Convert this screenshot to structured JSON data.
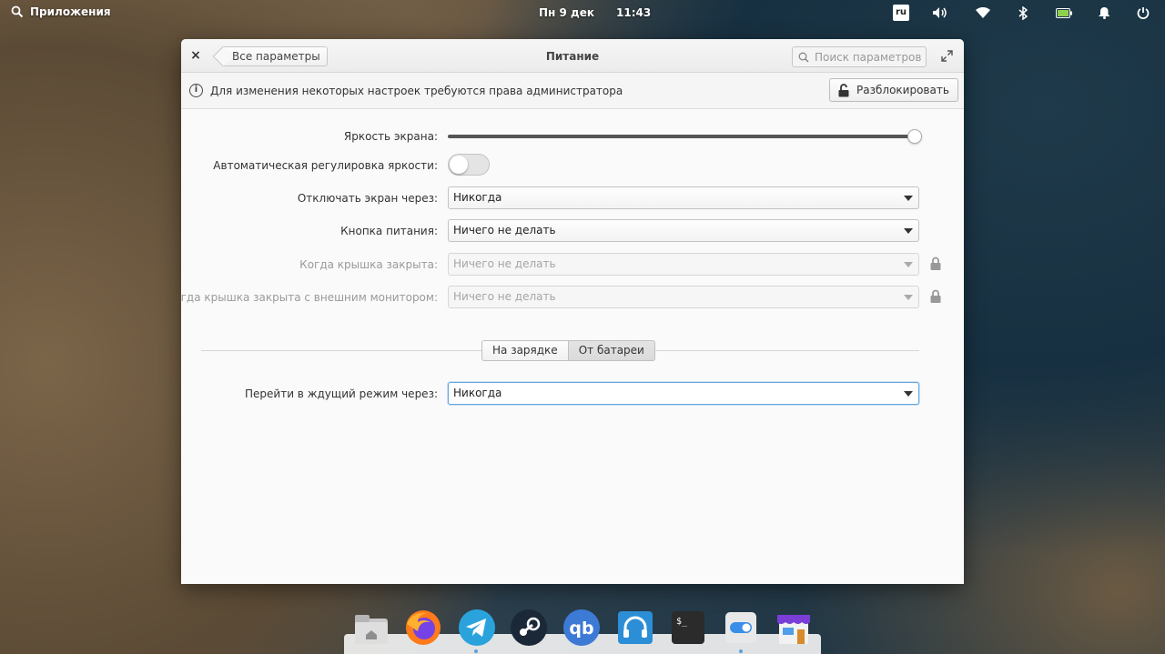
{
  "panel": {
    "applications_label": "Приложения",
    "date": "Пн  9 дек",
    "time": "11:43",
    "keyboard_layout": "ru"
  },
  "window": {
    "title": "Питание",
    "back_label": "Все параметры",
    "search_placeholder": "Поиск параметров"
  },
  "infobar": {
    "message": "Для изменения некоторых настроек требуются права администратора",
    "unlock_label": "Разблокировать"
  },
  "settings": {
    "brightness_label": "Яркость экрана:",
    "brightness_value": 1.0,
    "auto_brightness_label": "Автоматическая регулировка яркости:",
    "auto_brightness_enabled": false,
    "screen_off_label": "Отключать экран через:",
    "screen_off_value": "Никогда",
    "power_button_label": "Кнопка питания:",
    "power_button_value": "Ничего не делать",
    "lid_closed_label": "Когда крышка закрыта:",
    "lid_closed_value": "Ничего не делать",
    "lid_closed_monitor_label": "Когда крышка закрыта с внешним монитором:",
    "lid_closed_monitor_value": "Ничего не делать"
  },
  "mode_switch": {
    "charging_label": "На зарядке",
    "battery_label": "От батареи",
    "selected": "От батареи"
  },
  "sleep": {
    "label": "Перейти в ждущий режим через:",
    "value": "Никогда"
  },
  "dock": {
    "apps": [
      "files-icon",
      "firefox-icon",
      "telegram-icon",
      "steam-icon",
      "qbittorrent-icon",
      "audio-player-icon",
      "terminal-icon",
      "settings-icon",
      "appcenter-icon"
    ]
  },
  "colors": {
    "accent": "#64a6e2",
    "window_bg": "#fafafa"
  }
}
